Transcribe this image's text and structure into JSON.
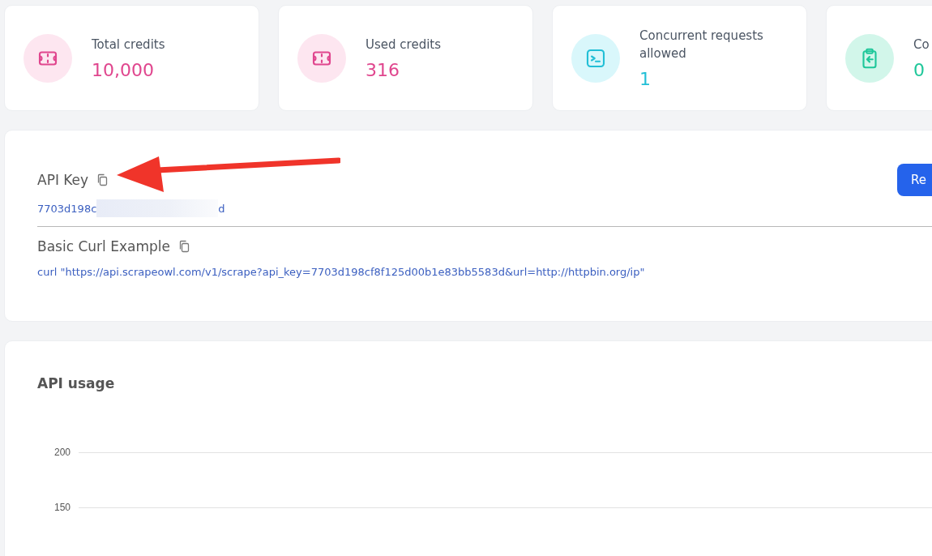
{
  "stats": [
    {
      "kind": "ticket",
      "label": "Total credits",
      "value": "10,000",
      "color": "#e0468e"
    },
    {
      "kind": "ticket",
      "label": "Used credits",
      "value": "316",
      "color": "#e0468e"
    },
    {
      "kind": "terminal",
      "label": "Concurrent requests allowed",
      "value": "1",
      "color": "#22bfd6"
    },
    {
      "kind": "clipboard",
      "label": "Co",
      "value": "0",
      "color": "#1fc79a"
    }
  ],
  "api_key": {
    "title": "API Key",
    "key_start": "7703d198c",
    "key_end": "d",
    "button": "Re"
  },
  "curl": {
    "title": "Basic Curl Example",
    "command": "curl \"https://api.scrapeowl.com/v1/scrape?api_key=7703d198cf8f125d00b1e83bb5583d&url=http://httpbin.org/ip\""
  },
  "usage": {
    "title": "API usage",
    "y_ticks": [
      "200",
      "150"
    ]
  }
}
